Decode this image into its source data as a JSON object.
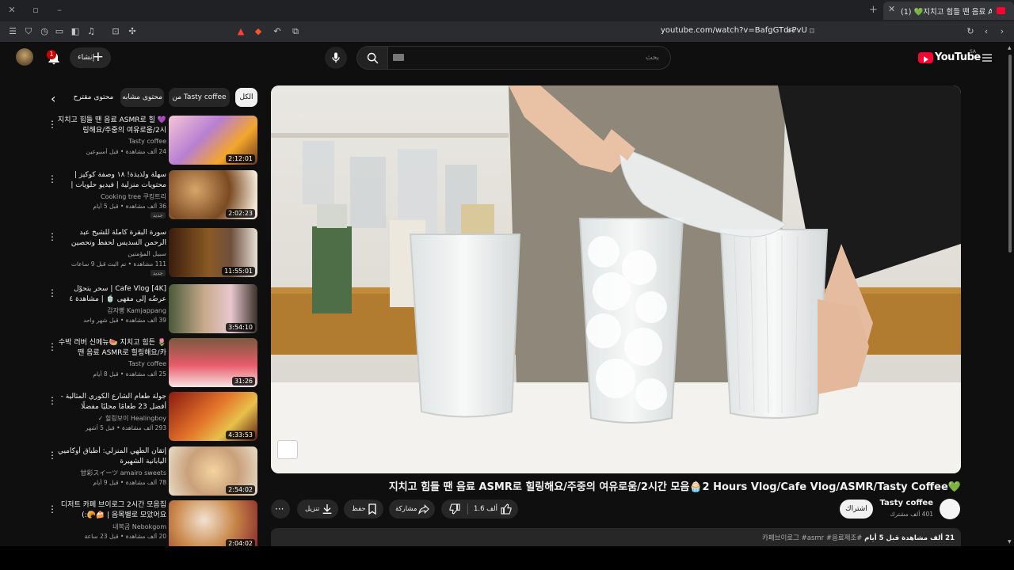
{
  "browser": {
    "tab_title": "(1) 💚지치고 힘들 땐 음료 ASMR로 힐링해요",
    "url": "youtube.com/watch?v=BafgGTdrPvU"
  },
  "header": {
    "notif_count": "1",
    "create_label": "إنشاء",
    "search_placeholder": "بحث",
    "logo_text": "YouTube",
    "region": "SA"
  },
  "chips": [
    {
      "label": "الكل"
    },
    {
      "label": "من Tasty coffee"
    },
    {
      "label": "محتوى مشابه"
    },
    {
      "label": "محتوى مقترح"
    }
  ],
  "sidebar_videos": [
    {
      "title": "💜 지치고 힘들 땐 음료 ASMR로 힐링해요/주중의 여유로움/2시",
      "channel": "Tasty coffee",
      "meta": "24 ألف مشاهدة • قبل أسبوعين",
      "duration": "2:12:01",
      "badge": ""
    },
    {
      "title": "سهلة ولذيذة! ١٨ وصفة كوكيز | محتويات منزلية | فيديو حلويات | شوكولاتة، ليمون، ...",
      "channel": "Cooking tree 쿠킹트리",
      "meta": "36 ألف مشاهدة • قبل 5 أيام",
      "duration": "2:02:23",
      "badge": "جديد"
    },
    {
      "title": "سورة البقرة كاملة للشيخ عبد الرحمن السديس لحفظ وتحصين المنزل وجلب البركة بإذن ...",
      "channel": "سبيل المؤمنين",
      "meta": "111 مشاهدة • تم البث قبل 9 ساعات",
      "duration": "11:55:01",
      "badge": "جديد"
    },
    {
      "title": "[4K] Cafe Vlog | سحر يتحوّل عرضُه إلى مقهى 🍵 | مشاهدة ٤ ساعات",
      "channel": "감자빵 Kamjappang",
      "meta": "39 ألف مشاهدة • قبل شهر واحد",
      "duration": "3:54:10",
      "badge": ""
    },
    {
      "title": "🌷 수박 러버 신메뉴🍉 지치고 힘든 땐 음료 ASMR로 힐링해요/카",
      "channel": "Tasty coffee",
      "meta": "25 ألف مشاهدة • قبل 8 أيام",
      "duration": "31:26",
      "badge": ""
    },
    {
      "title": "جولة طعام الشارع الكوري المثالية - أفضل 23 طعامًا محليًا مفضلًا",
      "channel": "힐링보이 Healingboy ✓",
      "meta": "293 ألف مشاهدة • قبل 5 أشهر",
      "duration": "4:33:53",
      "badge": ""
    },
    {
      "title": "إتقان الطهي المنزلي: أطباق أوكاميي اليابانية الشهيرة",
      "channel": "甘彩スイーツ amairo sweets",
      "meta": "78 ألف مشاهدة • قبل 9 أيام",
      "duration": "2:54:02",
      "badge": ""
    },
    {
      "title": "디저트 카페 브이로그 2시간 모음집 🥐🍰 | 음목별로 모았어요:)",
      "channel": "내복곰 Nebokgom",
      "meta": "20 ألف مشاهدة • قبل 23 ساعة",
      "duration": "2:04:02",
      "badge": ""
    }
  ],
  "video": {
    "title": "💚지치고 힘들 땐 음료 ASMR로 힐링해요/주중의 여유로움/2시간 모음🧁2 Hours Vlog/Cafe Vlog/ASMR/Tasty Coffee",
    "channel": "Tasty coffee",
    "subscribers": "401 ألف مشترك",
    "subscribe_label": "اشتراك",
    "likes": "1.6 ألف",
    "share_label": "مشاركة",
    "save_label": "حفظ",
    "download_label": "تنزيل",
    "desc_stats": "21 ألف مشاهدة قبل 5 أيام",
    "desc_tags": "#카페브이로그 #asmr #음료제조"
  },
  "colors": {
    "background": "#0f0f0f",
    "brand_red": "#ff0033",
    "chip": "#272727"
  }
}
